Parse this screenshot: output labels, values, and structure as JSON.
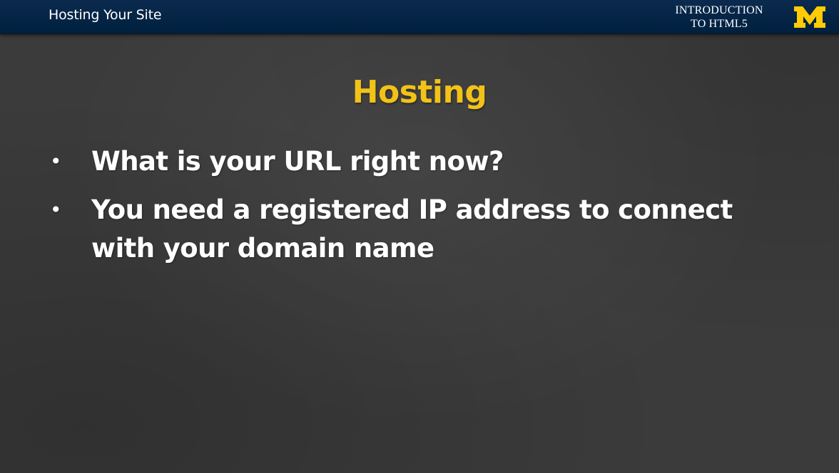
{
  "header": {
    "title": "Hosting Your Site",
    "course_line1": "INTRODUCTION",
    "course_line2": "TO HTML5",
    "logo_icon": "block-m-logo-icon",
    "logo_color": "#ffcb05",
    "bar_color": "#00274c"
  },
  "slide": {
    "heading": "Hosting",
    "heading_color": "#f2c218",
    "bullets": [
      "What is your URL right now?",
      "You need a registered IP address to connect with your domain name"
    ],
    "bullet_symbol": "•"
  }
}
